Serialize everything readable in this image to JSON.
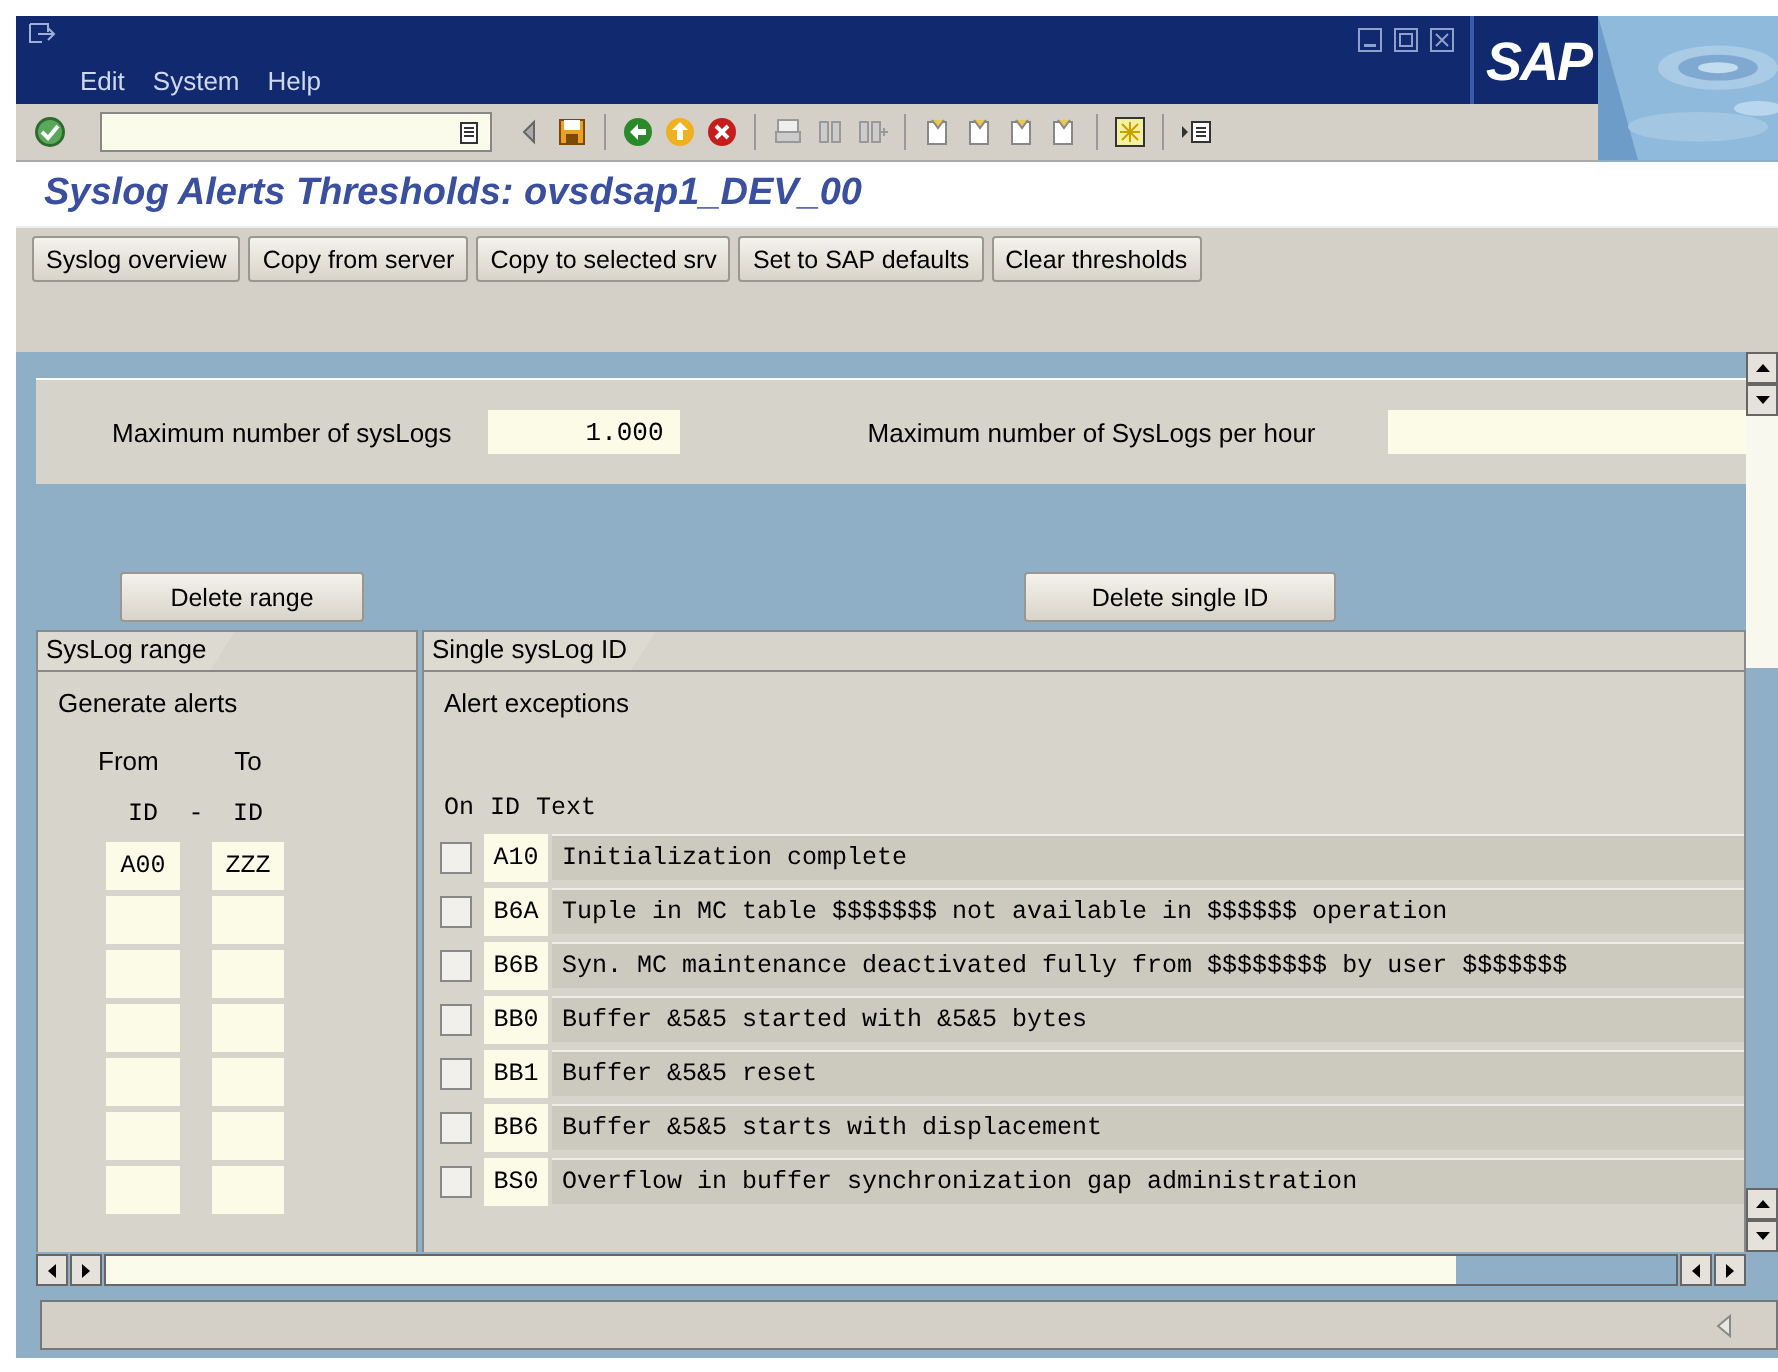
{
  "menu": [
    {
      "label": "Edit"
    },
    {
      "label": "System"
    },
    {
      "label": "Help"
    }
  ],
  "logo": "SAP",
  "title": "Syslog Alerts Thresholds: ovsdsap1_DEV_00",
  "app_buttons": [
    {
      "label": "Syslog overview"
    },
    {
      "label": "Copy from server"
    },
    {
      "label": "Copy to selected srv"
    },
    {
      "label": "Set to SAP defaults"
    },
    {
      "label": "Clear thresholds"
    }
  ],
  "limits": [
    {
      "label": "Maximum number of sysLogs",
      "value": "1.000"
    },
    {
      "label": "Maximum number of SysLogs per hour"
    }
  ],
  "range_panel": {
    "button": "Delete range",
    "tab": "SysLog range",
    "heading": "Generate alerts",
    "from_header": "From",
    "to_header": "To",
    "from_id": "ID",
    "dash": "-",
    "to_id": "ID",
    "rows": [
      {
        "from": "A00",
        "to": "ZZZ"
      },
      {},
      {},
      {},
      {},
      {},
      {}
    ]
  },
  "exceptions_panel": {
    "button": "Delete single ID",
    "tab": "Single sysLog ID",
    "heading": "Alert exceptions",
    "columns": [
      "On",
      "ID",
      "Text"
    ],
    "rows": [
      {
        "on": false,
        "id": "A10",
        "text": "Initialization complete"
      },
      {
        "on": false,
        "id": "B6A",
        "text": "Tuple in MC table $$$$$$$ not available in $$$$$$ operation"
      },
      {
        "on": false,
        "id": "B6B",
        "text": "Syn. MC maintenance deactivated fully from $$$$$$$$ by user $$$$$$$"
      },
      {
        "on": false,
        "id": "BB0",
        "text": "Buffer &5&5 started with &5&5 bytes"
      },
      {
        "on": false,
        "id": "BB1",
        "text": "Buffer &5&5 reset"
      },
      {
        "on": false,
        "id": "BB6",
        "text": "Buffer &5&5 starts with displacement"
      },
      {
        "on": false,
        "id": "BS0",
        "text": "Overflow in buffer synchronization gap administration"
      }
    ]
  }
}
